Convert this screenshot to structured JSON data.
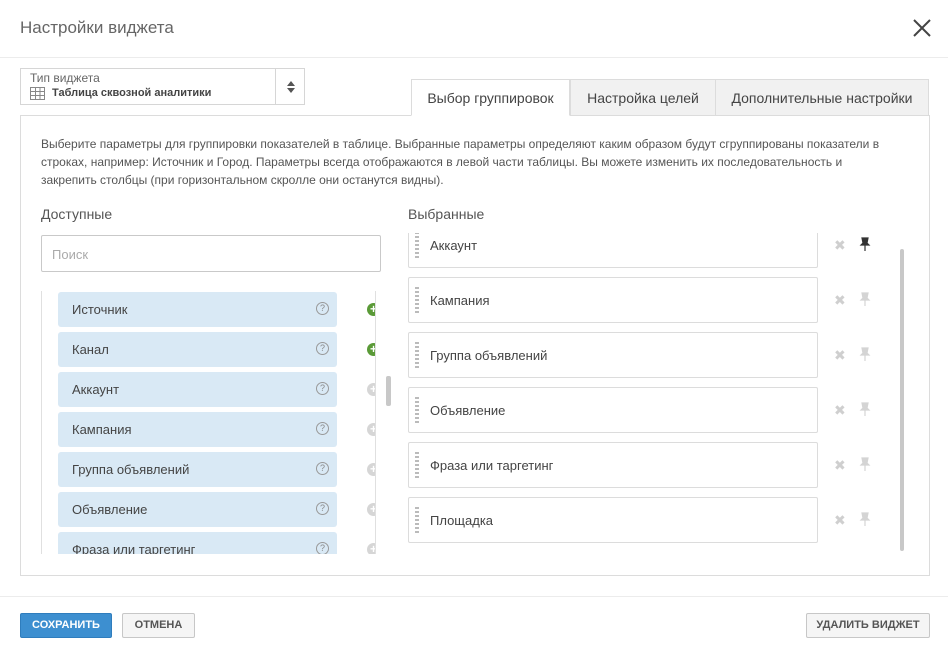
{
  "dialog": {
    "title": "Настройки виджета"
  },
  "widget_type": {
    "label": "Тип виджета",
    "value": "Таблица сквозной аналитики"
  },
  "tabs": [
    {
      "label": "Выбор группировок",
      "active": true
    },
    {
      "label": "Настройка целей",
      "active": false
    },
    {
      "label": "Дополнительные настройки",
      "active": false
    }
  ],
  "description": "Выберите параметры для группировки показателей в таблице. Выбранные параметры определяют каким образом будут сгруппированы показатели в строках, например: Источник и Город. Параметры всегда отображаются в левой части таблицы. Вы можете изменить их последовательность и закрепить столбцы (при горизонтальном скролле они останутся видны).",
  "available": {
    "title": "Доступные",
    "search_placeholder": "Поиск",
    "items": [
      {
        "label": "Источник",
        "help": "?",
        "add_enabled": true
      },
      {
        "label": "Канал",
        "help": "?",
        "add_enabled": true
      },
      {
        "label": "Аккаунт",
        "help": "?",
        "add_enabled": false
      },
      {
        "label": "Кампания",
        "help": "?",
        "add_enabled": false
      },
      {
        "label": "Группа объявлений",
        "help": "?",
        "add_enabled": false
      },
      {
        "label": "Объявление",
        "help": "?",
        "add_enabled": false
      },
      {
        "label": "Фраза или таргетинг",
        "help": "?",
        "add_enabled": false
      }
    ]
  },
  "selected": {
    "title": "Выбранные",
    "items": [
      {
        "label": "Аккаунт",
        "pinned": true
      },
      {
        "label": "Кампания",
        "pinned": false
      },
      {
        "label": "Группа объявлений",
        "pinned": false
      },
      {
        "label": "Объявление",
        "pinned": false
      },
      {
        "label": "Фраза или таргетинг",
        "pinned": false
      },
      {
        "label": "Площадка",
        "pinned": false
      }
    ]
  },
  "footer": {
    "save_label": "СОХРАНИТЬ",
    "cancel_label": "ОТМЕНА",
    "delete_label": "УДАЛИТЬ ВИДЖЕТ"
  },
  "colors": {
    "accent": "#3d8fd0",
    "add_enabled": "#5a9a37",
    "item_bg": "#d9e9f5",
    "pin_active": "#333333",
    "pin_inactive": "#cfcfcf"
  }
}
